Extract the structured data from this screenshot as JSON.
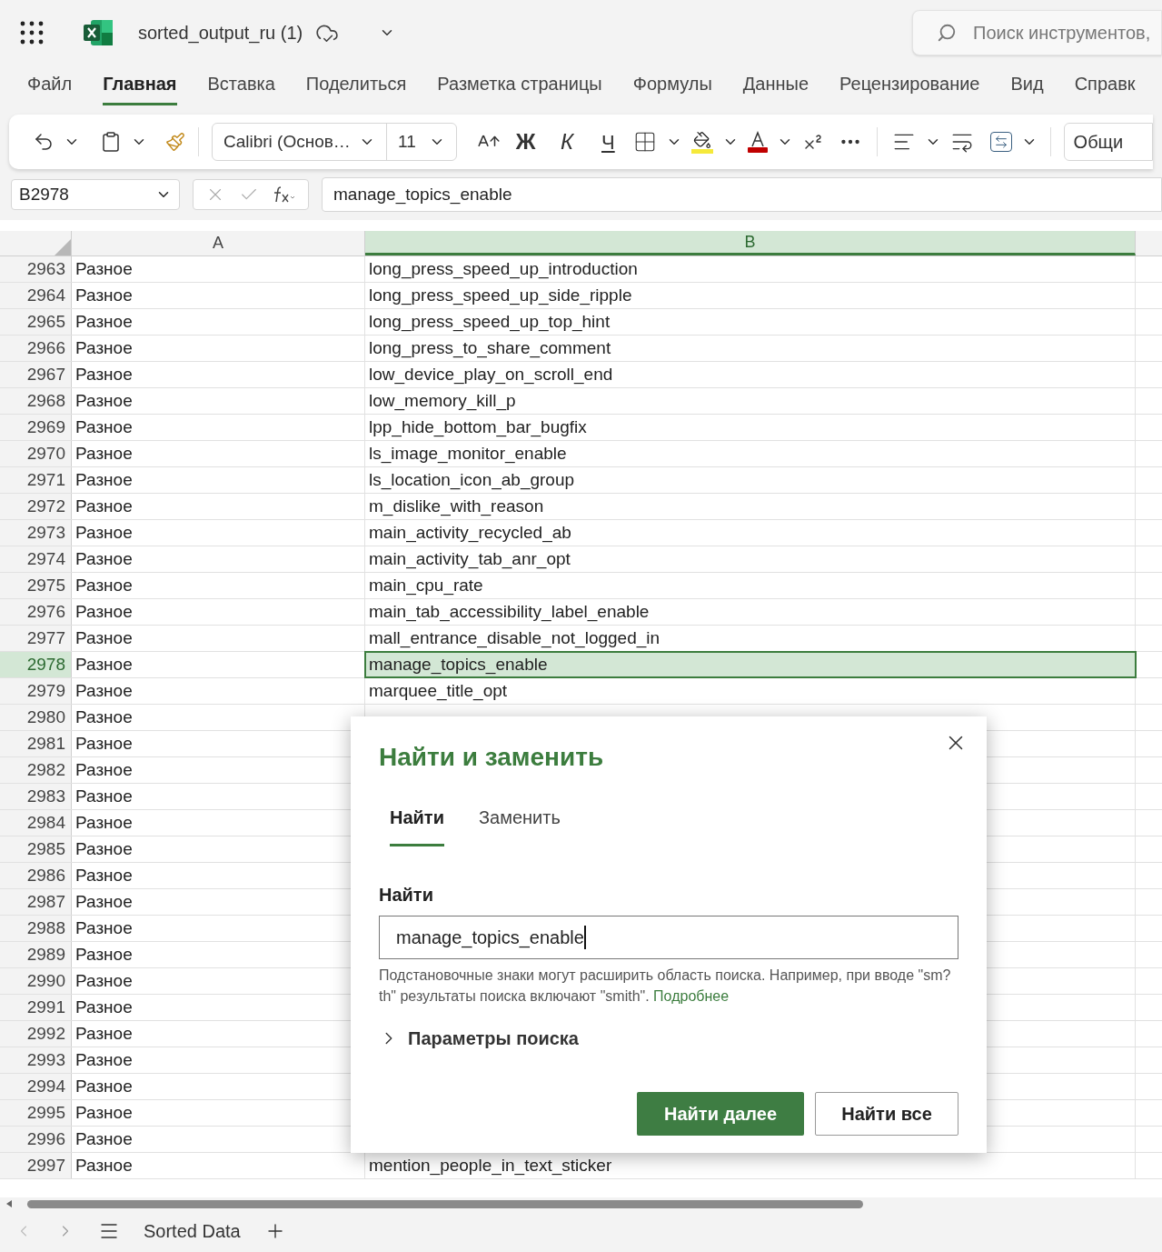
{
  "title_bar": {
    "file_name": "sorted_output_ru (1)",
    "search": {
      "placeholder": "Поиск инструментов,"
    }
  },
  "ribbon_tabs": [
    {
      "label": "Файл",
      "selected": false
    },
    {
      "label": "Главная",
      "selected": true
    },
    {
      "label": "Вставка",
      "selected": false
    },
    {
      "label": "Поделиться",
      "selected": false
    },
    {
      "label": "Разметка страницы",
      "selected": false
    },
    {
      "label": "Формулы",
      "selected": false
    },
    {
      "label": "Данные",
      "selected": false
    },
    {
      "label": "Рецензирование",
      "selected": false
    },
    {
      "label": "Вид",
      "selected": false
    },
    {
      "label": "Справк",
      "selected": false
    }
  ],
  "toolbar": {
    "font_name": "Calibri (Основ…",
    "font_size": "11",
    "bold": "Ж",
    "italic": "К",
    "underline": "Ч",
    "number_format": "Общи"
  },
  "formula_bar": {
    "name_box": "B2978",
    "formula": "manage_topics_enable"
  },
  "columns": [
    {
      "label": "A",
      "selected": false
    },
    {
      "label": "B",
      "selected": true
    }
  ],
  "rows": [
    {
      "number": "2963",
      "a": "Разное",
      "b": "long_press_speed_up_introduction",
      "selected": false
    },
    {
      "number": "2964",
      "a": "Разное",
      "b": "long_press_speed_up_side_ripple",
      "selected": false
    },
    {
      "number": "2965",
      "a": "Разное",
      "b": "long_press_speed_up_top_hint",
      "selected": false
    },
    {
      "number": "2966",
      "a": "Разное",
      "b": "long_press_to_share_comment",
      "selected": false
    },
    {
      "number": "2967",
      "a": "Разное",
      "b": "low_device_play_on_scroll_end",
      "selected": false
    },
    {
      "number": "2968",
      "a": "Разное",
      "b": "low_memory_kill_p",
      "selected": false
    },
    {
      "number": "2969",
      "a": "Разное",
      "b": "lpp_hide_bottom_bar_bugfix",
      "selected": false
    },
    {
      "number": "2970",
      "a": "Разное",
      "b": "ls_image_monitor_enable",
      "selected": false
    },
    {
      "number": "2971",
      "a": "Разное",
      "b": "ls_location_icon_ab_group",
      "selected": false
    },
    {
      "number": "2972",
      "a": "Разное",
      "b": "m_dislike_with_reason",
      "selected": false
    },
    {
      "number": "2973",
      "a": "Разное",
      "b": "main_activity_recycled_ab",
      "selected": false
    },
    {
      "number": "2974",
      "a": "Разное",
      "b": "main_activity_tab_anr_opt",
      "selected": false
    },
    {
      "number": "2975",
      "a": "Разное",
      "b": "main_cpu_rate",
      "selected": false
    },
    {
      "number": "2976",
      "a": "Разное",
      "b": "main_tab_accessibility_label_enable",
      "selected": false
    },
    {
      "number": "2977",
      "a": "Разное",
      "b": "mall_entrance_disable_not_logged_in",
      "selected": false
    },
    {
      "number": "2978",
      "a": "Разное",
      "b": "manage_topics_enable",
      "selected": true
    },
    {
      "number": "2979",
      "a": "Разное",
      "b": "marquee_title_opt",
      "selected": false
    },
    {
      "number": "2980",
      "a": "Разное",
      "selected": false
    },
    {
      "number": "2981",
      "a": "Разное",
      "selected": false
    },
    {
      "number": "2982",
      "a": "Разное",
      "selected": false
    },
    {
      "number": "2983",
      "a": "Разное",
      "selected": false
    },
    {
      "number": "2984",
      "a": "Разное",
      "selected": false
    },
    {
      "number": "2985",
      "a": "Разное",
      "selected": false
    },
    {
      "number": "2986",
      "a": "Разное",
      "selected": false
    },
    {
      "number": "2987",
      "a": "Разное",
      "selected": false
    },
    {
      "number": "2988",
      "a": "Разное",
      "selected": false
    },
    {
      "number": "2989",
      "a": "Разное",
      "selected": false
    },
    {
      "number": "2990",
      "a": "Разное",
      "selected": false
    },
    {
      "number": "2991",
      "a": "Разное",
      "selected": false
    },
    {
      "number": "2992",
      "a": "Разное",
      "selected": false
    },
    {
      "number": "2993",
      "a": "Разное",
      "selected": false
    },
    {
      "number": "2994",
      "a": "Разное",
      "selected": false
    },
    {
      "number": "2995",
      "a": "Разное",
      "selected": false
    },
    {
      "number": "2996",
      "a": "Разное",
      "selected": false
    },
    {
      "number": "2997",
      "a": "Разное",
      "b": "mention_people_in_text_sticker",
      "selected": false
    }
  ],
  "dialog": {
    "title": "Найти и заменить",
    "tabs": [
      {
        "label": "Найти",
        "selected": true
      },
      {
        "label": "Заменить",
        "selected": false
      }
    ],
    "field_label": "Найти",
    "value": "manage_topics_enable",
    "hint": "Подстановочные знаки могут расширить область поиска. Например, при вводе \"sm?th\" результаты поиска включают \"smith\".",
    "link": "Подробнее",
    "options": "Параметры поиска",
    "expanded": false,
    "buttons": [
      {
        "label": "Найти далее",
        "kind": "primary"
      },
      {
        "label": "Найти все",
        "kind": "secondary"
      }
    ]
  },
  "sheet_tabs": [
    {
      "label": "Sorted Data",
      "selected": true
    }
  ]
}
